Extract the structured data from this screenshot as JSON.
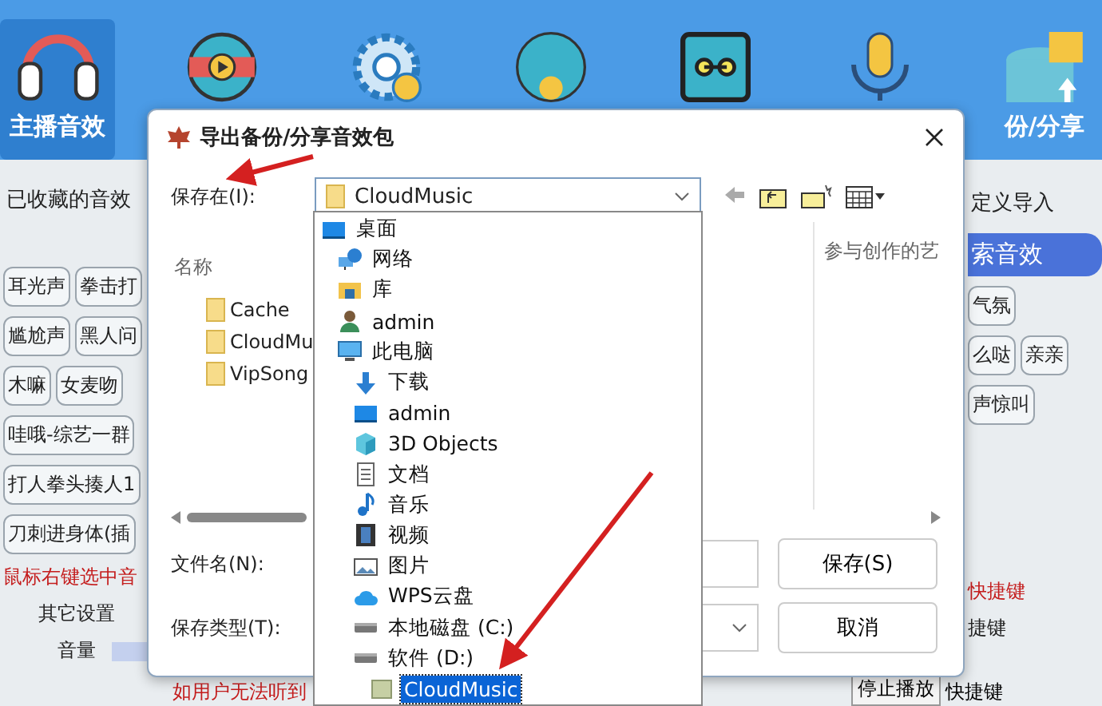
{
  "toolbar": {
    "items": [
      {
        "label": "主播音效",
        "kind": "headphones",
        "selected": true
      },
      {
        "kind": "video-disc",
        "selected": false
      },
      {
        "kind": "gear",
        "selected": false
      },
      {
        "kind": "round",
        "selected": false
      },
      {
        "kind": "cassette",
        "selected": false
      },
      {
        "kind": "microphone",
        "selected": false
      },
      {
        "label": "份/分享",
        "kind": "database",
        "selected": false
      }
    ]
  },
  "left_panel": {
    "tab": "已收藏的音效",
    "chip_rows": [
      [
        "耳光声",
        "拳击打"
      ],
      [
        "尴尬声",
        "黑人问"
      ],
      [
        "木嘛",
        "女麦吻"
      ],
      [
        "哇哦-综艺一群"
      ],
      [
        "打人拳头揍人1"
      ],
      [
        "刀刺进身体(插"
      ]
    ],
    "notice": "鼠标右键选中音",
    "settings": "其它设置",
    "volume": {
      "label": "音量",
      "level": 1
    }
  },
  "footer_notice": "如用户无法听到",
  "right_panel": {
    "tabs": [
      {
        "label": "定义导入",
        "selected": false
      },
      {
        "label": "索音效",
        "selected": true
      }
    ],
    "chip_rows": [
      [
        "气氛"
      ],
      [
        "么哒",
        "亲亲"
      ],
      [
        "声惊叫"
      ]
    ],
    "shortcut_notice": "快捷键",
    "shortcut_label": "捷键"
  },
  "bottom_bar": {
    "stop_button": "停止播放",
    "stop_shortcut": "快捷键"
  },
  "dialog": {
    "title": "导出备份/分享音效包",
    "save_in_label": "保存在(I):",
    "location": "CloudMusic",
    "column_1": "名称",
    "column_2": "参与创作的艺",
    "files": [
      "Cache",
      "CloudMu",
      "VipSong"
    ],
    "file_name_label": "文件名(N):",
    "file_type_label": "保存类型(T):",
    "save_button": "保存(S)",
    "cancel_button": "取消"
  },
  "location_list": {
    "items": [
      {
        "label": "桌面",
        "kind": "desktop",
        "selected": false,
        "children": [
          {
            "label": "网络",
            "kind": "network",
            "selected": false
          },
          {
            "label": "库",
            "kind": "library",
            "selected": false
          },
          {
            "label": "admin",
            "kind": "user",
            "selected": false
          },
          {
            "label": "此电脑",
            "kind": "computer",
            "selected": false,
            "children": [
              {
                "label": "下载",
                "kind": "download",
                "selected": false
              },
              {
                "label": "admin",
                "kind": "desktop",
                "selected": false
              },
              {
                "label": "3D Objects",
                "kind": "cube",
                "selected": false
              },
              {
                "label": "文档",
                "kind": "document",
                "selected": false
              },
              {
                "label": "音乐",
                "kind": "music",
                "selected": false
              },
              {
                "label": "视频",
                "kind": "video",
                "selected": false
              },
              {
                "label": "图片",
                "kind": "picture",
                "selected": false
              },
              {
                "label": "WPS云盘",
                "kind": "cloud",
                "selected": false
              },
              {
                "label": "本地磁盘 (C:)",
                "kind": "drive",
                "selected": false
              },
              {
                "label": "软件 (D:)",
                "kind": "drive",
                "selected": false,
                "children": [
                  {
                    "label": "CloudMusic",
                    "kind": "folder",
                    "selected": true
                  }
                ]
              }
            ]
          }
        ]
      }
    ]
  }
}
